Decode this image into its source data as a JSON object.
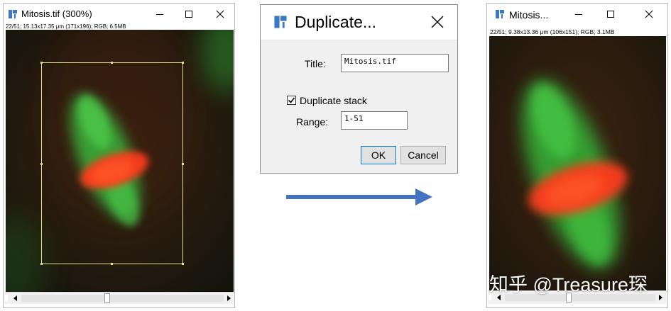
{
  "left_window": {
    "title": "Mitosis.tif (300%)",
    "info": "22/51; 15.13x17.35 μm (171x196); RGB; 6.5MB",
    "minimize_icon": "minimize-icon",
    "maximize_icon": "maximize-icon",
    "close_icon": "close-icon"
  },
  "dialog": {
    "title": "Duplicate...",
    "title_label": "Title:",
    "title_value": "Mitosis.tif",
    "duplicate_stack_label": "Duplicate stack",
    "duplicate_stack_checked": true,
    "range_label": "Range:",
    "range_value": "1-51",
    "ok_label": "OK",
    "cancel_label": "Cancel"
  },
  "right_window": {
    "title": "Mitosis...",
    "info": "22/51; 9.38x13.36 μm (106x151); RGB; 3.1MB"
  },
  "watermark": "知乎 @Treasure琛",
  "colors": {
    "arrow": "#4472c4",
    "selection": "#e6e08a",
    "green_channel": "#39c43c",
    "red_channel": "#ff3b1a",
    "background": "#1d1a0f"
  }
}
